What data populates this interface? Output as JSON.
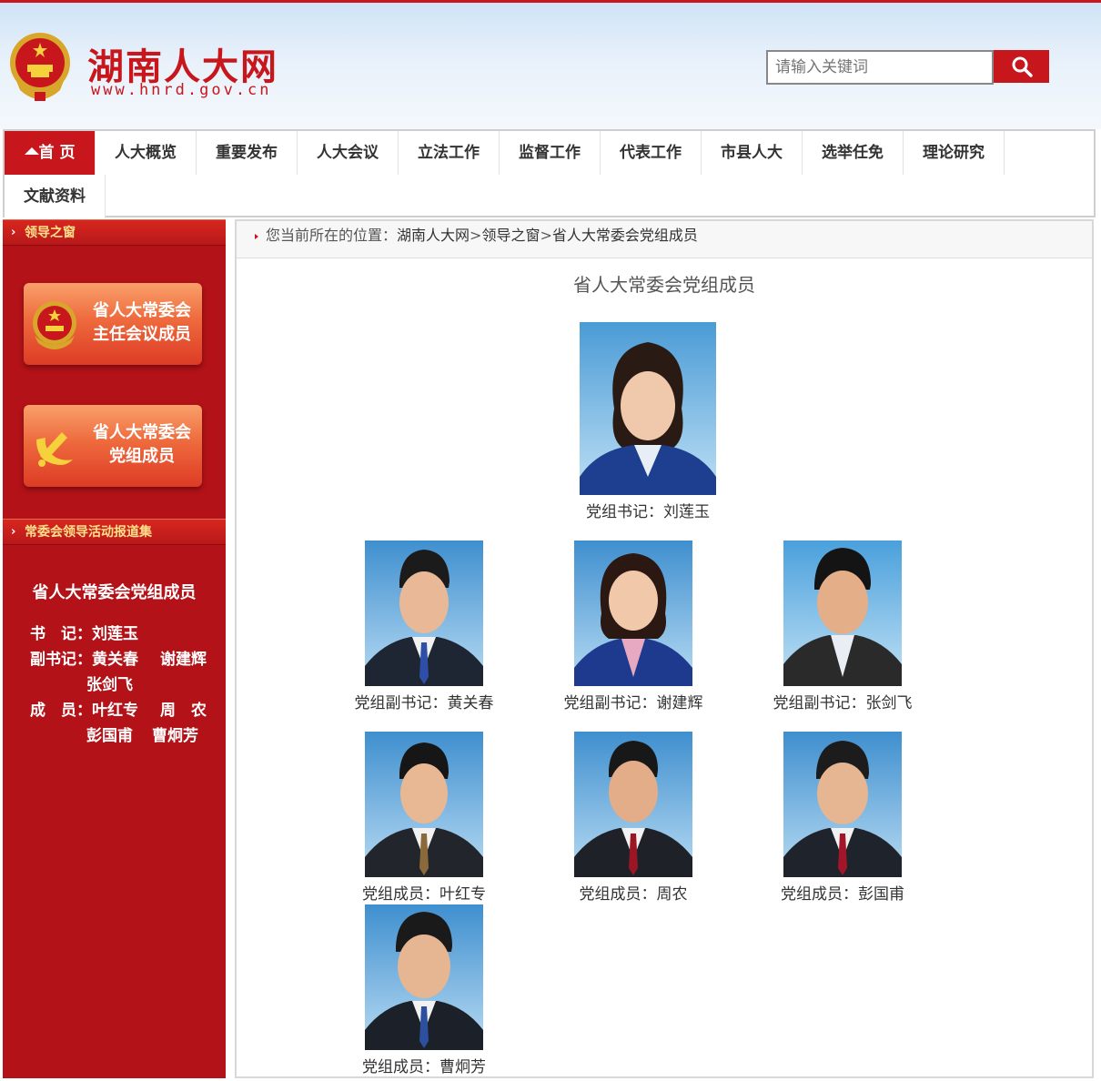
{
  "header": {
    "site_name": "湖南人大网",
    "site_url": "www.hnrd.gov.cn",
    "search_placeholder": "请输入关键词"
  },
  "nav": {
    "items": [
      {
        "label": "首 页"
      },
      {
        "label": "人大概览"
      },
      {
        "label": "重要发布"
      },
      {
        "label": "人大会议"
      },
      {
        "label": "立法工作"
      },
      {
        "label": "监督工作"
      },
      {
        "label": "代表工作"
      },
      {
        "label": "市县人大"
      },
      {
        "label": "选举任免"
      },
      {
        "label": "理论研究"
      },
      {
        "label": "文献资料"
      }
    ]
  },
  "sidebar": {
    "section1_title": "领导之窗",
    "button1_line1": "省人大常委会",
    "button1_line2": "主任会议成员",
    "button2_line1": "省人大常委会",
    "button2_line2": "党组成员",
    "section2_title": "常委会领导活动报道集",
    "roster_title": "省人大常委会党组成员",
    "roster": {
      "secretary_label": "书　记：",
      "secretary": "刘莲玉",
      "deputy_label": "副书记：",
      "deputy_1": "黄关春",
      "deputy_2": "谢建辉",
      "deputy_3": "张剑飞",
      "member_label": "成　员：",
      "member_1": "叶红专",
      "member_2": "周　农",
      "member_3": "彭国甫",
      "member_4": "曹炯芳"
    }
  },
  "main": {
    "breadcrumb_prefix": "您当前所在的位置：",
    "crumb_1": "湖南人大网",
    "crumb_sep": ">",
    "crumb_2": "领导之窗",
    "crumb_3": "省人大常委会党组成员",
    "title": "省人大常委会党组成员",
    "members": [
      {
        "caption": "党组书记：刘莲玉"
      },
      {
        "caption": "党组副书记：黄关春"
      },
      {
        "caption": "党组副书记：谢建辉"
      },
      {
        "caption": "党组副书记：张剑飞"
      },
      {
        "caption": "党组成员：叶红专"
      },
      {
        "caption": "党组成员：周农"
      },
      {
        "caption": "党组成员：彭国甫"
      },
      {
        "caption": "党组成员：曹炯芳"
      }
    ]
  },
  "colors": {
    "brand_red": "#c8161d",
    "sidebar_red": "#b31218",
    "accent_gold": "#ffe08a"
  },
  "icons": [
    "national-emblem-icon",
    "search-icon",
    "home-icon",
    "party-emblem-icon",
    "chevron-right-icon"
  ]
}
